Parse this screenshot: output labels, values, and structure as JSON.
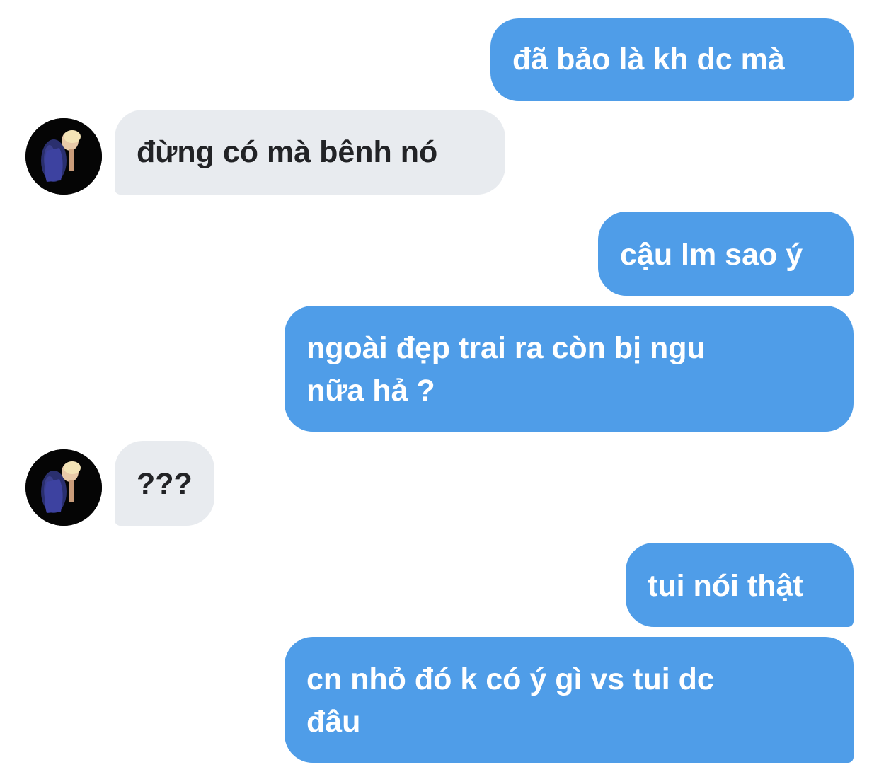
{
  "colors": {
    "sent_bubble": "#4f9de8",
    "received_bubble": "#e8ebef",
    "sent_text": "#ffffff",
    "received_text": "#222326",
    "background": "#ffffff"
  },
  "contact": {
    "avatar_icon": "profile-photo"
  },
  "messages": [
    {
      "sender": "me",
      "text": "đã bảo là kh dc mà"
    },
    {
      "sender": "contact",
      "text": "đừng có mà bênh nó"
    },
    {
      "sender": "me",
      "text": "cậu lm sao ý"
    },
    {
      "sender": "me",
      "lines": [
        "ngoài đẹp trai ra còn bị ngu",
        "nữa hả ?"
      ]
    },
    {
      "sender": "contact",
      "text": "???"
    },
    {
      "sender": "me",
      "text": "tui nói thật"
    },
    {
      "sender": "me",
      "lines": [
        "cn nhỏ đó k có ý gì vs tui dc",
        "đâu"
      ]
    }
  ]
}
